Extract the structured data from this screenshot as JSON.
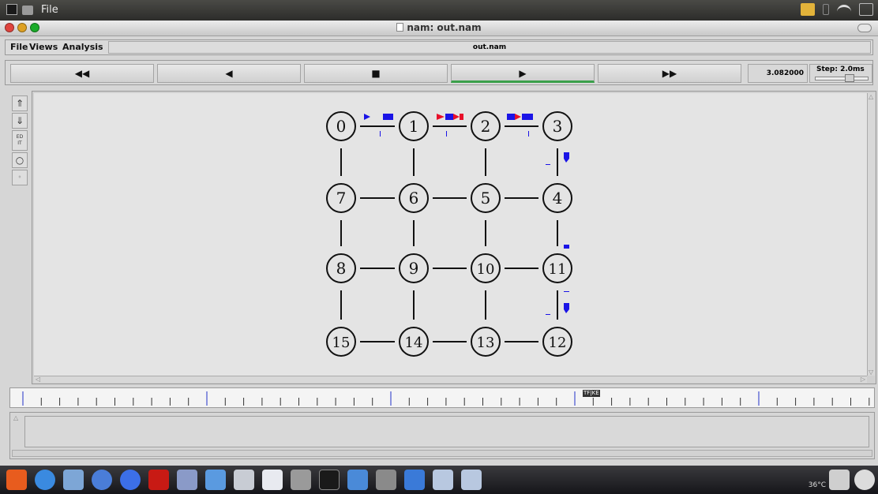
{
  "system_bar": {
    "menu_label": "File"
  },
  "window": {
    "title": "nam: out.nam"
  },
  "menubar": {
    "items": [
      "File",
      "Views",
      "Analysis"
    ],
    "file_field": "out.nam"
  },
  "playback": {
    "rewind_label": "◀◀",
    "back_label": "◀",
    "stop_label": "■",
    "play_label": "▶",
    "forward_label": "▶▶",
    "time_value": "3.082000",
    "step_label": "Step: 2.0ms"
  },
  "tools": {
    "edit_label": "ED\nIT"
  },
  "topology": {
    "nodes": [
      "0",
      "1",
      "2",
      "3",
      "7",
      "6",
      "5",
      "4",
      "8",
      "9",
      "10",
      "11",
      "15",
      "14",
      "13",
      "12"
    ]
  },
  "timeline": {
    "marker_text": "TF|KE"
  },
  "dock": {
    "weather": "36°C"
  },
  "colors": {
    "packet_red": "#e8102a",
    "packet_blue": "#1a14e6",
    "play_active": "#3aa04a"
  }
}
